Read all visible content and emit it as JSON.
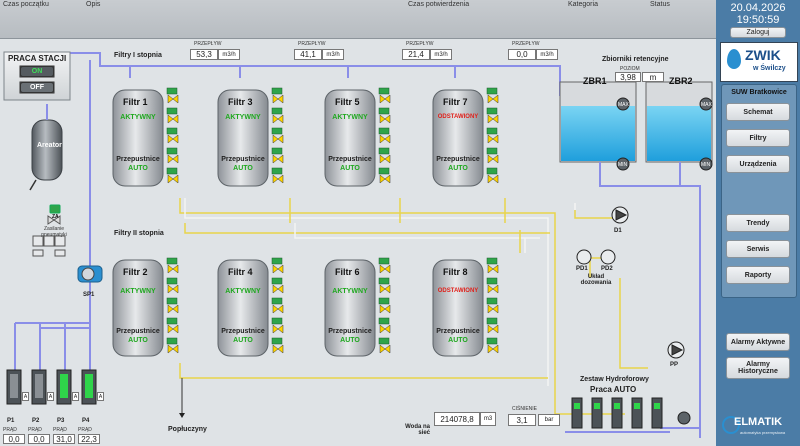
{
  "alarm_bar": {
    "col_start": "Czas początku",
    "col_desc": "Opis",
    "col_confirm": "Czas potwierdzenia",
    "col_category": "Kategoria",
    "col_status": "Status"
  },
  "clock": {
    "date": "20.04.2026",
    "time": "19:50:59"
  },
  "login_button": "Zaloguj",
  "logo": {
    "brand": "ZWIK",
    "sub": "w Świlczy"
  },
  "station_name": "SUW Bratkowice",
  "nav": [
    "Schemat",
    "Filtry",
    "Urządzenia",
    "Trendy",
    "Serwis",
    "Raporty",
    "Alarmy Aktywne",
    "Alarmy Historyczne"
  ],
  "station_work": {
    "title": "PRACA STACJI",
    "on": "ON",
    "off": "OFF"
  },
  "stage1_title": "Filtry I stopnia",
  "stage2_title": "Filtry II stopnia",
  "flow_caption": "PRZEPŁYW",
  "flow_unit": "m3/h",
  "flows": [
    "53,3",
    "41,1",
    "21,4",
    "0,0"
  ],
  "filters": [
    {
      "name": "Filtr 1",
      "status": "AKTYWNY",
      "status_color": "#1fa81f",
      "bypass": "Przepustnice",
      "mode": "AUTO"
    },
    {
      "name": "Filtr 3",
      "status": "AKTYWNY",
      "status_color": "#1fa81f",
      "bypass": "Przepustnice",
      "mode": "AUTO"
    },
    {
      "name": "Filtr 5",
      "status": "AKTYWNY",
      "status_color": "#1fa81f",
      "bypass": "Przepustnice",
      "mode": "AUTO"
    },
    {
      "name": "Filtr 7",
      "status": "ODSTAWIONY",
      "status_color": "#e0201a",
      "bypass": "Przepustnice",
      "mode": "AUTO"
    },
    {
      "name": "Filtr 2",
      "status": "AKTYWNY",
      "status_color": "#1fa81f",
      "bypass": "Przepustnice",
      "mode": "AUTO"
    },
    {
      "name": "Filtr 4",
      "status": "AKTYWNY",
      "status_color": "#1fa81f",
      "bypass": "Przepustnice",
      "mode": "AUTO"
    },
    {
      "name": "Filtr 6",
      "status": "AKTYWNY",
      "status_color": "#1fa81f",
      "bypass": "Przepustnice",
      "mode": "AUTO"
    },
    {
      "name": "Filtr 8",
      "status": "ODSTAWIONY",
      "status_color": "#e0201a",
      "bypass": "Przepustnice",
      "mode": "AUTO"
    }
  ],
  "aerator": {
    "label": "Areator",
    "valve": "ZA",
    "valve_caption": "Zasilanie pneumatyki",
    "compressor": "SP1"
  },
  "retention": {
    "title": "Zbiorniki retencyjne",
    "level_caption": "POZIOM",
    "level_value": "3,98",
    "level_unit": "m",
    "tank1": "ZBR1",
    "tank2": "ZBR2",
    "max_tag": "MAX",
    "min_tag": "MIN"
  },
  "devices": {
    "d1": "D1",
    "pd1": "PD1",
    "pd2": "PD2",
    "dosing": "Układ dozowania",
    "pp": "PP",
    "backwash": "Popłuczyny"
  },
  "hydrophore": {
    "title": "Zestaw Hydroforowy",
    "mode": "Praca AUTO"
  },
  "network": {
    "label": "Woda na sieć",
    "total_value": "214078,8",
    "total_unit": "m3",
    "pressure_caption": "CIŚNIENIE",
    "pressure_value": "3,1",
    "pressure_unit": "bar"
  },
  "wells": [
    {
      "name": "P1",
      "current_caption": "PRĄD",
      "current": "0,0"
    },
    {
      "name": "P2",
      "current_caption": "PRĄD",
      "current": "0,0"
    },
    {
      "name": "P3",
      "current_caption": "PRĄD",
      "current": "31,0"
    },
    {
      "name": "P4",
      "current_caption": "PRĄD",
      "current": "22,3"
    }
  ],
  "mode_letter": "A",
  "footer_brand": {
    "name": "ELMATIK",
    "sub": "automatyka przemysłowa"
  },
  "colors": {
    "panel": "#4b7ca6",
    "water": "#36b4e6",
    "pipe_blue": "#8a8ee8",
    "pipe_yellow": "#e8d44a",
    "pipe_white": "#f4f4f4",
    "active": "#1fa81f",
    "stopped": "#e0201a"
  }
}
